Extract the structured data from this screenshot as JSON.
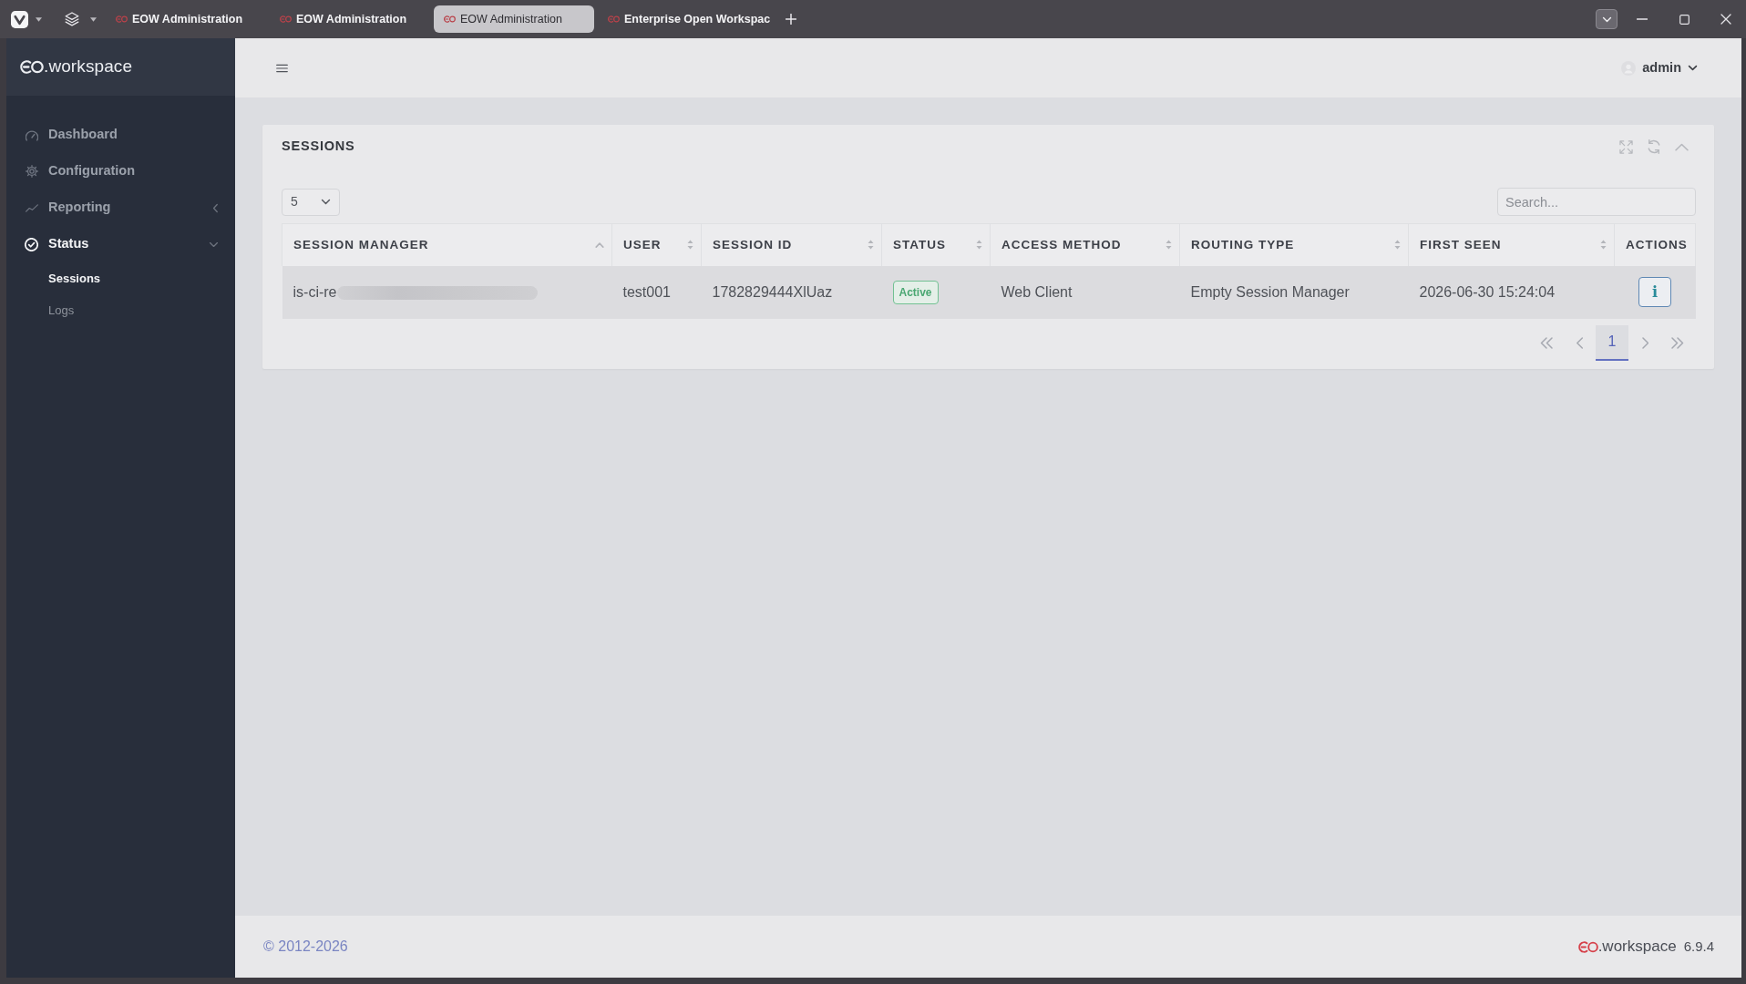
{
  "browser": {
    "tabs": [
      {
        "title": "EOW Administration",
        "selected": false
      },
      {
        "title": "EOW Administration",
        "selected": false
      },
      {
        "title": "EOW Administration",
        "selected": true
      },
      {
        "title": "Enterprise Open Workspac",
        "selected": false
      }
    ]
  },
  "sidebar": {
    "brand": ".workspace",
    "items": [
      {
        "kind": "link",
        "label": "Dashboard",
        "selected": false
      },
      {
        "kind": "link",
        "label": "Configuration",
        "selected": false
      },
      {
        "kind": "group",
        "label": "Reporting",
        "selected": false,
        "expanded": false
      },
      {
        "kind": "group",
        "label": "Status",
        "selected": true,
        "expanded": true,
        "children": [
          {
            "label": "Sessions",
            "selected": true
          },
          {
            "label": "Logs",
            "selected": false
          }
        ]
      }
    ]
  },
  "top_bar": {
    "user": "admin"
  },
  "sessions_card": {
    "title": "SESSIONS",
    "page_size": "5",
    "search": {
      "placeholder": "Search..."
    },
    "table": {
      "columns": [
        {
          "label": "SESSION MANAGER",
          "sortable": true,
          "sorted": true
        },
        {
          "label": "USER",
          "sortable": true,
          "sorted": false
        },
        {
          "label": "SESSION ID",
          "sortable": true,
          "sorted": false
        },
        {
          "label": "STATUS",
          "sortable": true,
          "sorted": false
        },
        {
          "label": "ACCESS METHOD",
          "sortable": true,
          "sorted": false
        },
        {
          "label": "ROUTING TYPE",
          "sortable": true,
          "sorted": false
        },
        {
          "label": "FIRST SEEN",
          "sortable": true,
          "sorted": false
        },
        {
          "label": "ACTIONS",
          "sortable": false
        }
      ],
      "rows": [
        {
          "session_manager": {
            "text": "is-ci-re",
            "redacted": true
          },
          "user": "test001",
          "session_id": "1782829444XlUaz",
          "status": {
            "label": "Active",
            "kind": "active"
          },
          "access_method": "Web Client",
          "routing_type": "Empty Session Manager",
          "first_seen": "2026-06-30 15:24:04",
          "action": "i"
        }
      ]
    },
    "pagination": {
      "pages": [
        {
          "label": "1",
          "selected": true
        }
      ]
    }
  },
  "footer": {
    "copyright": "© 2012-2026",
    "brand": ".workspace",
    "version": "6.9.4"
  }
}
